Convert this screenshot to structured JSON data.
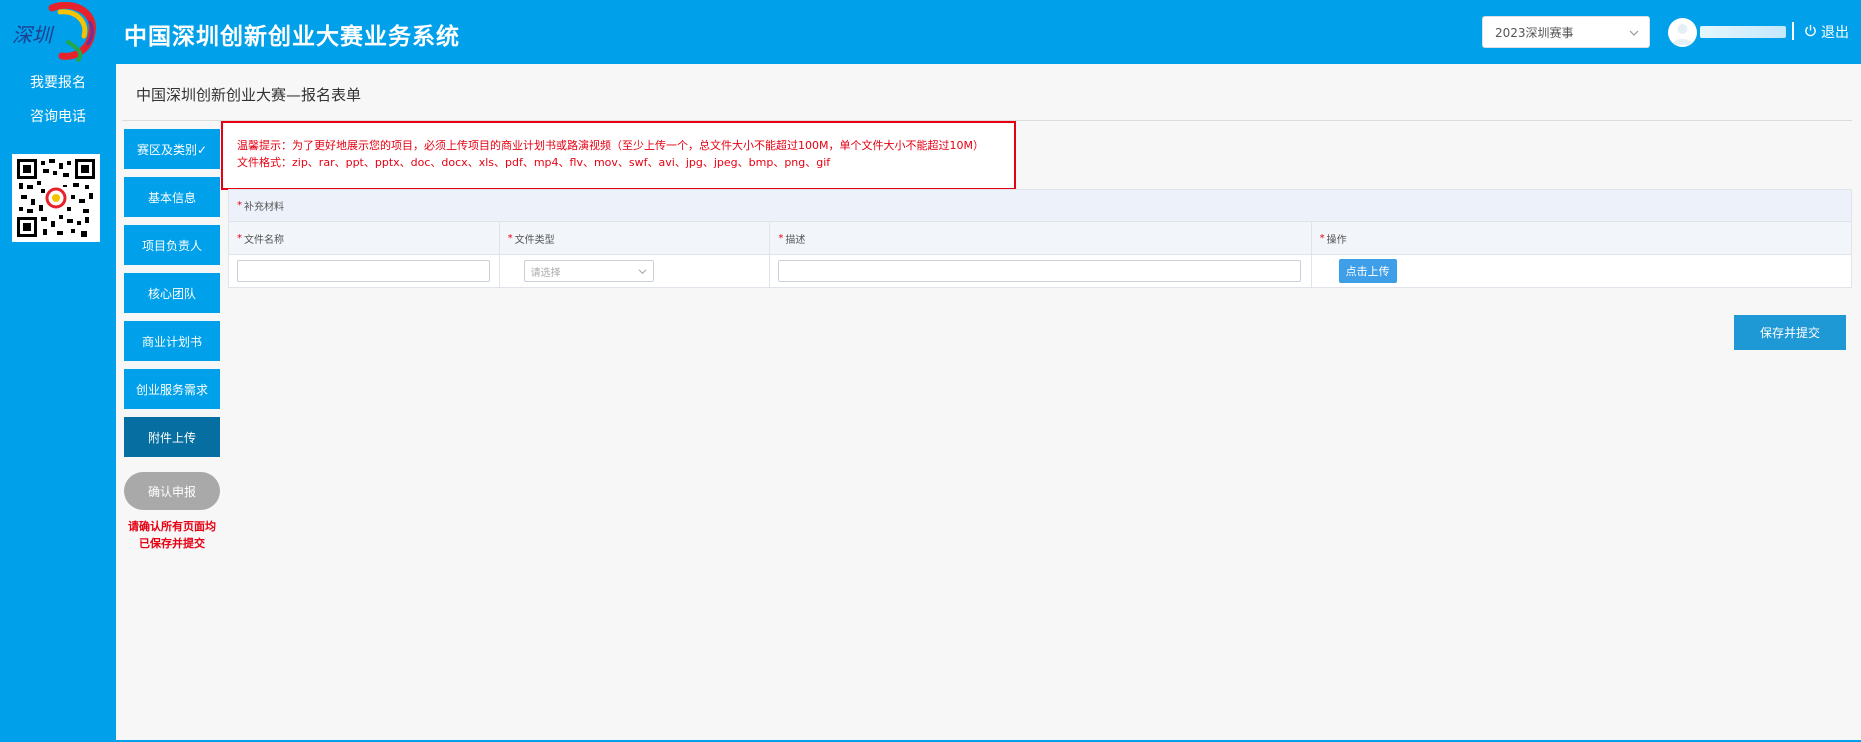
{
  "header": {
    "logo_text": "深圳",
    "app_title": "中国深圳创新创业大赛业务系统",
    "season_select": "2023深圳赛事",
    "logout_label": "退出"
  },
  "sidebar": {
    "links": [
      "我要报名",
      "咨询电话"
    ]
  },
  "page": {
    "title": "中国深圳创新创业大赛—报名表单"
  },
  "steps": [
    {
      "label": "赛区及类别✓",
      "active": false
    },
    {
      "label": "基本信息",
      "active": false
    },
    {
      "label": "项目负责人",
      "active": false
    },
    {
      "label": "核心团队",
      "active": false
    },
    {
      "label": "商业计划书",
      "active": false
    },
    {
      "label": "创业服务需求",
      "active": false
    },
    {
      "label": "附件上传",
      "active": true
    }
  ],
  "confirm": {
    "button_label": "确认申报",
    "note_line1": "请确认所有页面均",
    "note_line2": "已保存并提交"
  },
  "notice": {
    "line1": "温馨提示：为了更好地展示您的项目，必须上传项目的商业计划书或路演视频（至少上传一个，总文件大小不能超过100M，单个文件大小不能超过10M）",
    "line2": "文件格式：zip、rar、ppt、pptx、doc、docx、xls、pdf、mp4、flv、mov、swf、avi、jpg、jpeg、bmp、png、gif"
  },
  "table": {
    "caption": "补充材料",
    "columns": [
      "文件名称",
      "文件类型",
      "描述",
      "操作"
    ],
    "row": {
      "file_name": "",
      "file_type_placeholder": "请选择",
      "description": "",
      "upload_label": "点击上传"
    }
  },
  "save_button": "保存并提交",
  "colors": {
    "primary": "#00a0ea",
    "active_step": "#066ea0",
    "warning": "#e60012",
    "disabled": "#a9a9a9"
  }
}
